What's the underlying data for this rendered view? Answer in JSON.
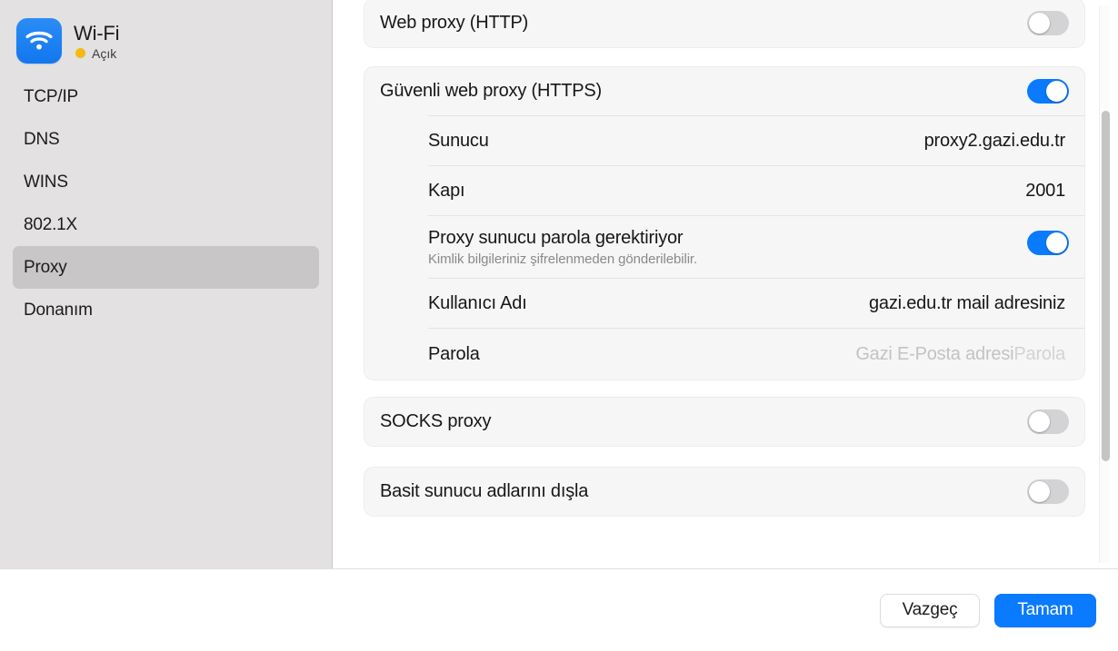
{
  "sidebar": {
    "device": {
      "icon": "wifi-icon",
      "name": "Wi-Fi",
      "status_label": "Açık",
      "status_dot_color": "#f5b912",
      "icon_color": "#1277ef"
    },
    "items": [
      {
        "label": "TCP/IP",
        "selected": false
      },
      {
        "label": "DNS",
        "selected": false
      },
      {
        "label": "WINS",
        "selected": false
      },
      {
        "label": "802.1X",
        "selected": false
      },
      {
        "label": "Proxy",
        "selected": true
      },
      {
        "label": "Donanım",
        "selected": false
      }
    ]
  },
  "main": {
    "cards": [
      {
        "title": "Web proxy (HTTP)",
        "toggle": "off"
      },
      {
        "title": "Güvenli web proxy (HTTPS)",
        "toggle": "on",
        "fields": [
          {
            "label": "Sunucu",
            "value": "proxy2.gazi.edu.tr"
          },
          {
            "label": "Kapı",
            "value": "2001"
          }
        ],
        "password_required": {
          "label": "Proxy sunucu parola gerektiriyor",
          "sublabel": "Kimlik bilgileriniz şifrelenmeden gönderilebilir.",
          "toggle": "on"
        },
        "credentials": [
          {
            "label": "Kullanıcı Adı",
            "value": "gazi.edu.tr mail adresiniz"
          }
        ],
        "password_row": {
          "label": "Parola",
          "annotation": "Gazi E-Posta adresi",
          "placeholder": "Parola"
        }
      },
      {
        "title": "SOCKS proxy",
        "toggle": "off"
      },
      {
        "title": "Basit sunucu adlarını dışla",
        "toggle": "off"
      }
    ]
  },
  "scrollbar": {
    "orientation": "vertical"
  },
  "footer": {
    "cancel_label": "Vazgeç",
    "ok_label": "Tamam",
    "accent_color": "#0a7aff"
  }
}
